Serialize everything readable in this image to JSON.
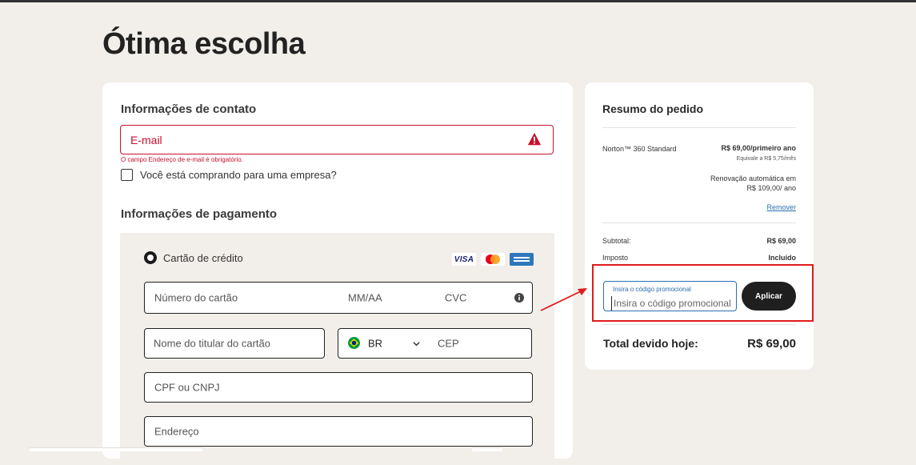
{
  "page": {
    "title": "Ótima escolha"
  },
  "contact": {
    "heading": "Informações de contato",
    "email_placeholder": "E-mail",
    "email_error": "O campo Endereço de e-mail é obrigatório.",
    "company_label": "Você está comprando para uma empresa?"
  },
  "payment": {
    "heading": "Informações de pagamento",
    "method_label": "Cartão de crédito",
    "logos": [
      "VISA",
      "mastercard-icon",
      "amex-icon"
    ],
    "visa_text": "VISA",
    "card_number_placeholder": "Número do cartão",
    "expiry_placeholder": "MM/AA",
    "cvc_placeholder": "CVC",
    "holder_placeholder": "Nome do titular do cartão",
    "country_value": "BR",
    "cep_placeholder": "CEP",
    "cpf_placeholder": "CPF ou CNPJ",
    "address_placeholder": "Endereço"
  },
  "summary": {
    "heading": "Resumo do pedido",
    "product_name": "Norton™ 360 Standard",
    "product_price": "R$ 69,00/primeiro ano",
    "product_monthly": "Equivale a R$ 5,75/mês",
    "renewal_line1": "Renovação automática em",
    "renewal_line2": "R$ 109,00/ ano",
    "remove_label": "Remover",
    "subtotal_label": "Subtotal:",
    "subtotal_value": "R$ 69,00",
    "tax_label": "Imposto",
    "tax_value": "Incluído",
    "promo_label": "Insira o código promocional",
    "promo_placeholder": "Insira o código promocional",
    "apply_label": "Aplicar",
    "total_label": "Total devido hoje:",
    "total_value": "R$ 69,00"
  },
  "colors": {
    "error": "#c8102e",
    "focus": "#2a6fb0",
    "highlight": "#e01b1b",
    "button": "#1f1f1f"
  }
}
